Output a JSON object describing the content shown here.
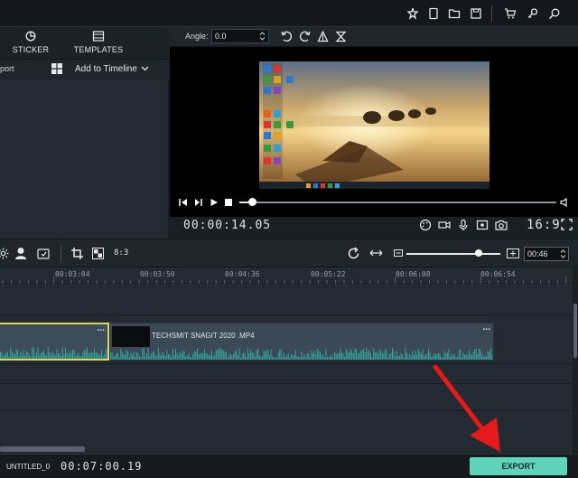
{
  "left_panel": {
    "tabs": [
      {
        "label": "STICKER",
        "icon": "sticker-icon"
      },
      {
        "label": "TEMPLATES",
        "icon": "templates-icon"
      }
    ],
    "import_label": "port",
    "add_to_timeline_label": "Add to Timeline"
  },
  "preview": {
    "angle_label": "Angle:",
    "angle_value": "0.0",
    "current_time": "00:00:14.05",
    "aspect_ratio": "16:9",
    "playhead_fraction": 0.04
  },
  "timeline": {
    "ruler_ticks": [
      "00:03:04",
      "00:03:50",
      "00:04:36",
      "00:05:22",
      "00:06:08",
      "00:06:54"
    ],
    "zoom_value": "00:46",
    "ratio_label": "8:3",
    "zoom_fraction": 0.77,
    "clip_name": "TECHSMIT SNAGIT 2020 .MP4",
    "clip_menu": "...",
    "prev_clip_menu": "..."
  },
  "status": {
    "project_name": "UNTITLED_0",
    "duration": "00:07:00.19",
    "export_label": "EXPORT"
  },
  "colors": {
    "accent": "#2fd6b5",
    "export_bg": "#5ed4b8",
    "clip_selected_border": "#d8d75a",
    "waveform": "#32a8a0",
    "arrow": "#e31b1b"
  }
}
